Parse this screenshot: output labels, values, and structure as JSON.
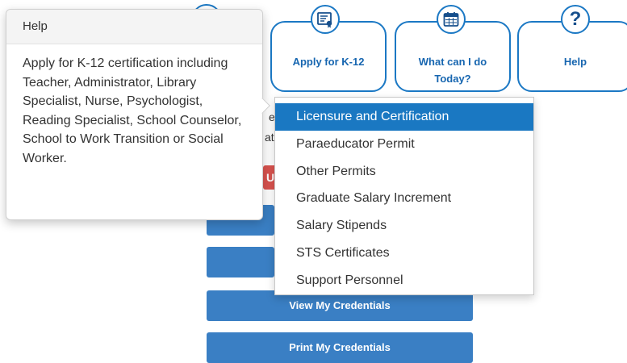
{
  "help_popover": {
    "title": "Help",
    "body": "Apply for K-12 certification including Teacher, Administrator, Library Specialist, Nurse, Psychologist, Reading Specialist, School Counselor, School to Work Transition or Social Worker."
  },
  "cards": [
    {
      "label_line1": "Apply for K-12",
      "label_line2": "",
      "icon": "certificate-icon"
    },
    {
      "label_line1": "What can I do",
      "label_line2": "Today?",
      "icon": "calendar-icon"
    },
    {
      "label_line1": "Help",
      "label_line2": "",
      "icon": "question-icon",
      "glyph": "?"
    }
  ],
  "dropdown": {
    "items": [
      "Licensure and Certification",
      "Paraeducator Permit",
      "Other Permits",
      "Graduate Salary Increment",
      "Salary Stipends",
      "STS Certificates",
      "Support Personnel"
    ],
    "active_index": 0
  },
  "partial": {
    "text_a": "e",
    "text_b": "at",
    "red_button_text": "U"
  },
  "buttons": {
    "view_credentials": "View My Credentials",
    "print_credentials": "Print My Credentials"
  },
  "colors": {
    "accent": "#1b78c4",
    "menu_active": "#1a78c2",
    "button_blue": "#3a7fc4",
    "danger": "#d9534f"
  }
}
